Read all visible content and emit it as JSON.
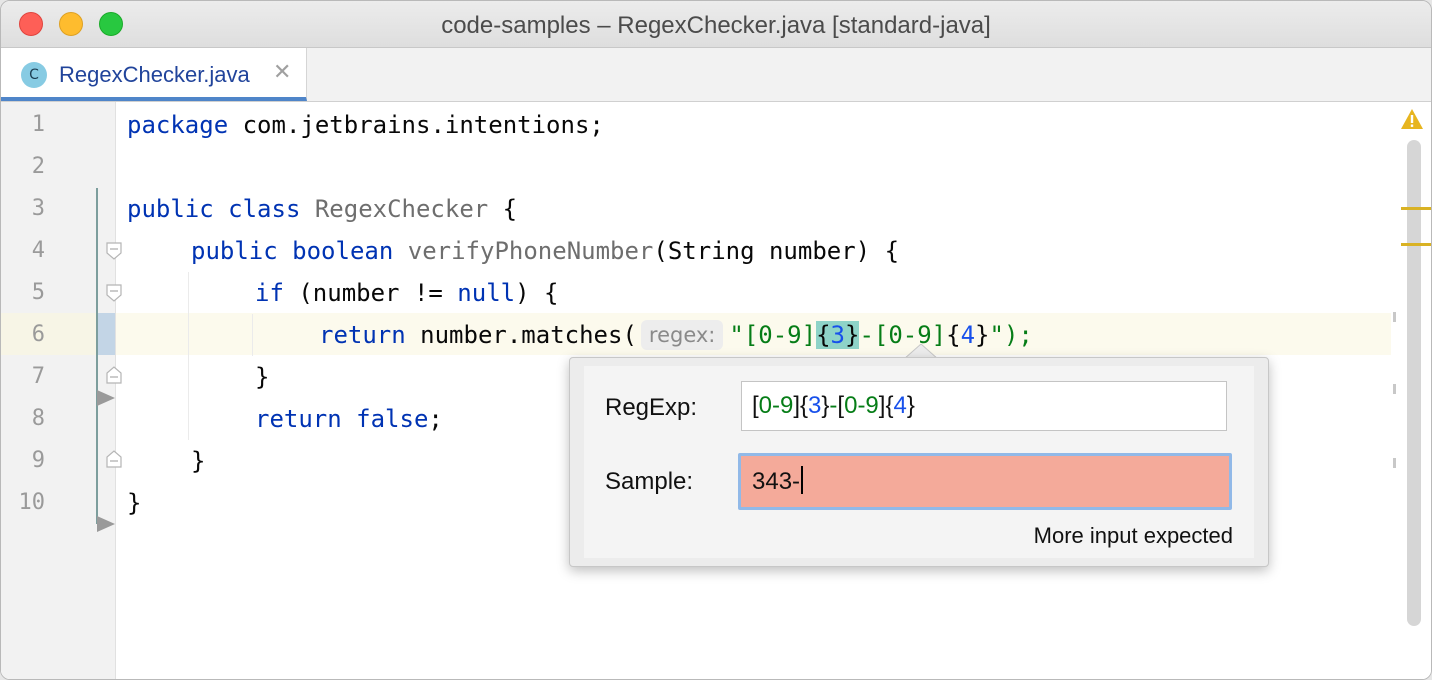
{
  "window": {
    "title": "code-samples – RegexChecker.java [standard-java]"
  },
  "tab": {
    "icon_letter": "C",
    "label": "RegexChecker.java",
    "close_glyph": "✕"
  },
  "gutter": {
    "line_numbers": [
      "1",
      "2",
      "3",
      "4",
      "5",
      "6",
      "7",
      "8",
      "9",
      "10"
    ]
  },
  "code": {
    "l1_kw": "package",
    "l1_rest": " com.jetbrains.intentions;",
    "l3_kw": "public class",
    "l3_name": " RegexChecker",
    "l3_rest": " {",
    "l4_kw": "public boolean",
    "l4_name": " verifyPhoneNumber",
    "l4_rest": "(String number) {",
    "l5_kw": "if",
    "l5_a": " (number != ",
    "l5_null": "null",
    "l5_b": ") {",
    "l6_kw": "return",
    "l6_rest": " number.matches(",
    "l6_hint": "regex:",
    "l6_q": "\"",
    "l6_s1": "[0-9]",
    "l6_m1": "{",
    "l6_n1": "3",
    "l6_m2": "}",
    "l6_s2": "-[0-9]",
    "l6_b1": "{",
    "l6_n2": "4",
    "l6_b2": "}",
    "l6_end": "\");",
    "l7": "}",
    "l8_kw": "return false",
    "l8_rest": ";",
    "l9": "}",
    "l10": "}"
  },
  "popup": {
    "regexp_label": "RegExp:",
    "regexp_value": {
      "p1": "[",
      "p2": "0-9",
      "p3": "]",
      "p4": "{",
      "p5": "3",
      "p6": "}",
      "p7": "-",
      "p8": "[",
      "p9": "0-9",
      "p10": "]",
      "p11": "{",
      "p12": "4",
      "p13": "}"
    },
    "sample_label": "Sample:",
    "sample_value": "343-",
    "status": "More input expected"
  },
  "colors": {
    "keyword": "#0033b3",
    "string": "#067d17",
    "number": "#1750eb",
    "sample_error_bg": "#f4aa9a",
    "match_highlight": "#8ed3c8"
  }
}
